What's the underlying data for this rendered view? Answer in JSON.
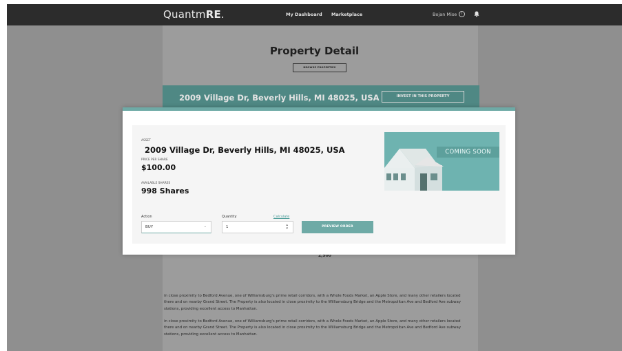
{
  "navbar": {
    "brand_prefix": "Quantm",
    "brand_suffix": "RE",
    "brand_dot": ".",
    "links": [
      "My Dashboard",
      "Marketplace"
    ],
    "user_name": "Bojan Mise",
    "user_icon": "user-circle-icon",
    "bell_icon": "bell-icon"
  },
  "page": {
    "title": "Property Detail",
    "browse_label": "BROWSE PROPERTIES",
    "banner_address": "2009 Village Dr, Beverly Hills, MI 48025, USA",
    "invest_label": "INVEST IN THIS PROPERTY",
    "bg_number": "2,900",
    "paragraphs": [
      "in close proximity to Bedford Avenue, one of Williamsburg's prime retail corridors, with a Whole Foods Market, an Apple Store, and many other retailers located there and on nearby Grand Street. The Property is also located in close proximity to the Williamsburg Bridge and the Metropolitan Ave and Bedford Ave subway stations, providing excellent access to Manhattan.",
      "in close proximity to Bedford Avenue, one of Williamsburg's prime retail corridors, with a Whole Foods Market, an Apple Store, and many other retailers located there and on nearby Grand Street. The Property is also located in close proximity to the Williamsburg Bridge and the Metropolitan Ave and Bedford Ave subway stations, providing excellent access to Manhattan."
    ]
  },
  "modal": {
    "asset_label": "ASSET",
    "asset_value": "2009 Village Dr, Beverly Hills, MI 48025, USA",
    "price_label": "PRICE PER SHARE",
    "price_value": "$100.00",
    "shares_label": "AVAILABLE SHARES",
    "shares_value": "998 Shares",
    "action_label": "Action",
    "action_value": "BUY",
    "quantity_label": "Quantity",
    "quantity_value": "1",
    "calculate_label": "Calculate",
    "preview_label": "PREVIEW ORDER",
    "image_badge": "COMING SOON"
  },
  "colors": {
    "accent": "#6eaaa6",
    "navbar": "#2c2c2c",
    "backdrop": "#8f8f8f"
  }
}
